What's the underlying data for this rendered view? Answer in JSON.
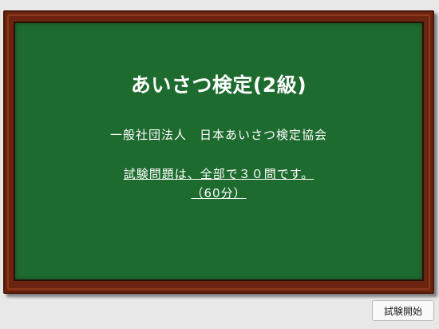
{
  "board": {
    "title": "あいさつ検定(2級)",
    "organization": "一般社団法人　日本あいさつ検定協会",
    "exam_info_line1": "試験問題は、全部で３０問です。",
    "exam_info_line2": "（60分）"
  },
  "footer": {
    "start_button_label": "試験開始"
  },
  "colors": {
    "chalkboard": "#1e6b2f",
    "frame": "#6b2410",
    "background": "#e8e8e8",
    "text": "#ffffff"
  }
}
